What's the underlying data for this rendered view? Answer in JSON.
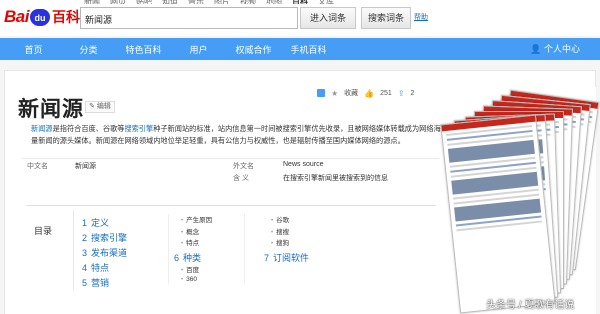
{
  "header": {
    "logo_left": "Bai",
    "logo_paw": "du",
    "logo_right": "百科",
    "top_nav": [
      "新闻",
      "网页",
      "贴吧",
      "知道",
      "音乐",
      "图片",
      "视频",
      "地图",
      "百科",
      "文库"
    ],
    "top_nav_active": 8,
    "search_value": "新闻源",
    "enter_button": "进入词条",
    "search_button": "搜索词条",
    "help_link": "帮助"
  },
  "navbar": {
    "items": [
      "首页",
      "分类",
      "特色百科",
      "用户",
      "权威合作",
      "手机百科"
    ],
    "user_center": "个人中心"
  },
  "entry": {
    "title": "新闻源",
    "edit_label": "编辑",
    "collect_label": "收藏",
    "likes": "251",
    "shares": "2",
    "summary_link1": "新闻源",
    "summary_part1": "是指符合百度、谷歌等",
    "summary_link2": "搜索引擎",
    "summary_part2": "种子新闻站的标准，站内信息第一时间被搜索引擎优先收录，且被网络媒体转载成为网络海量新闻的源头媒体。新闻源在网络领域内地位举足轻重，具有公信力与权威性，也是辐射传播至国内媒体网络的源点。"
  },
  "basic_info": [
    {
      "k1": "中文名",
      "v1": "新闻源",
      "k2": "外文名",
      "v2": "News source"
    },
    {
      "k1": "",
      "v1": "",
      "k2": "含    义",
      "v2": "在搜索引擎新闻里被搜索到的信息"
    }
  ],
  "catalog": {
    "label": "目录",
    "items": [
      {
        "num": "1",
        "label": "定义"
      },
      {
        "num": "2",
        "label": "搜索引擎"
      },
      {
        "num": "3",
        "label": "发布渠道"
      },
      {
        "num": "4",
        "label": "特点"
      },
      {
        "num": "5",
        "label": "营销"
      },
      {
        "num": "6",
        "label": "种类"
      },
      {
        "num": "7",
        "label": "订阅软件"
      }
    ],
    "subs_col1": [
      "产生原因",
      "概念",
      "特点"
    ],
    "subs_col2": [
      "谷歌",
      "搜搜",
      "搜狗"
    ],
    "subs_col3": [
      "百度",
      "360"
    ]
  },
  "colors": {
    "accent": "#459df5",
    "link": "#136ec2",
    "brand_red": "#e10601",
    "brand_blue": "#2932e1"
  },
  "watermark": "头条号 / 夏歌有话说"
}
